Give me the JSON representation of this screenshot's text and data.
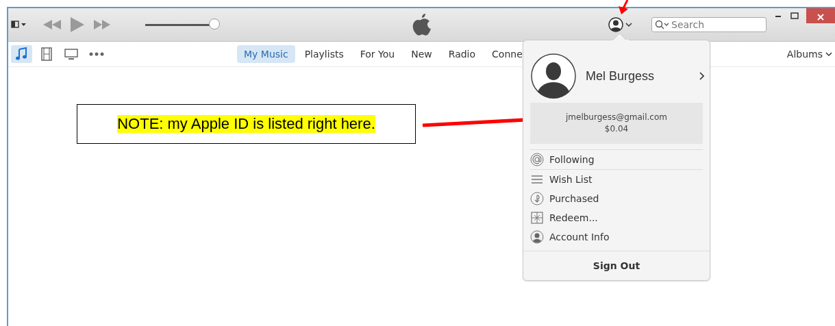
{
  "toolbar": {
    "volume": {
      "level": 0.97
    },
    "search": {
      "placeholder": "Search"
    }
  },
  "media_types": [
    {
      "kind": "music",
      "selected": true
    },
    {
      "kind": "film",
      "selected": false
    },
    {
      "kind": "tv",
      "selected": false
    },
    {
      "kind": "more",
      "selected": false
    }
  ],
  "nav_tabs": [
    {
      "label": "My Music",
      "selected": true
    },
    {
      "label": "Playlists",
      "selected": false
    },
    {
      "label": "For You",
      "selected": false
    },
    {
      "label": "New",
      "selected": false
    },
    {
      "label": "Radio",
      "selected": false
    },
    {
      "label": "Conne",
      "selected": false
    }
  ],
  "view_menu": {
    "label": "Albums"
  },
  "account_popup": {
    "name": "Mel Burgess",
    "apple_id": "jmelburgess@gmail.com",
    "balance": "$0.04",
    "items": [
      {
        "kind": "following",
        "label": "Following"
      },
      {
        "kind": "wishlist",
        "label": "Wish List"
      },
      {
        "kind": "purchased",
        "label": "Purchased"
      },
      {
        "kind": "redeem",
        "label": "Redeem..."
      },
      {
        "kind": "account",
        "label": "Account Info"
      }
    ],
    "sign_out": "Sign Out"
  },
  "annotation": {
    "note": "NOTE: my Apple ID is listed right here."
  }
}
